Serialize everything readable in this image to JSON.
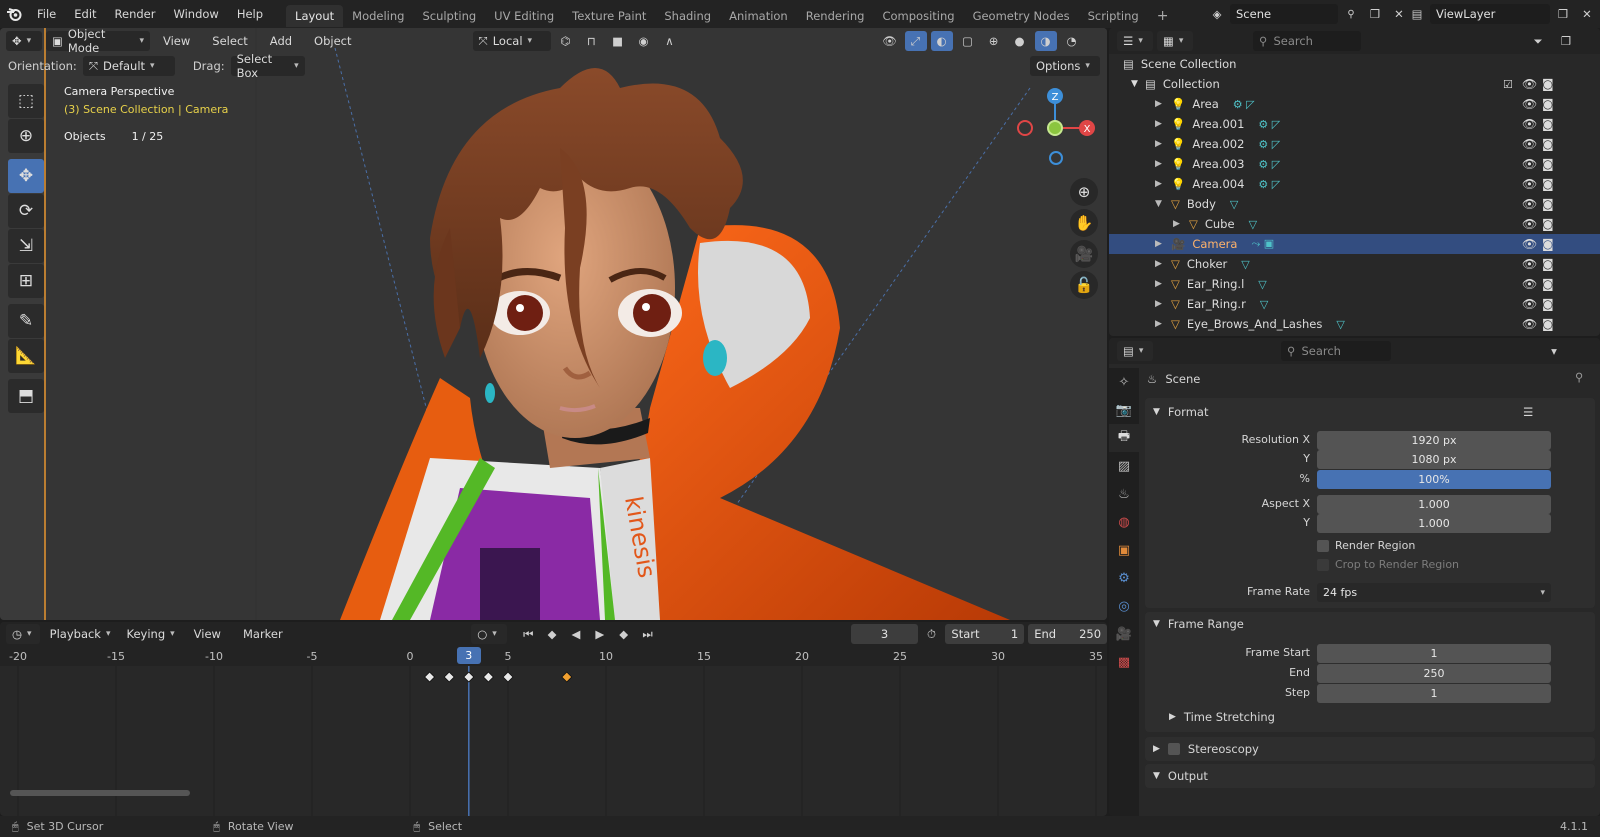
{
  "topbar": {
    "menus": [
      "File",
      "Edit",
      "Render",
      "Window",
      "Help"
    ],
    "workspaces": [
      "Layout",
      "Modeling",
      "Sculpting",
      "UV Editing",
      "Texture Paint",
      "Shading",
      "Animation",
      "Rendering",
      "Compositing",
      "Geometry Nodes",
      "Scripting"
    ],
    "active_workspace": "Layout",
    "scene": "Scene",
    "view_layer": "ViewLayer"
  },
  "viewport": {
    "mode": "Object Mode",
    "menus": [
      "View",
      "Select",
      "Add",
      "Object"
    ],
    "transform_orientation": "Local",
    "orientation_label": "Orientation:",
    "orientation_value": "Default",
    "drag_label": "Drag:",
    "drag_value": "Select Box",
    "options_label": "Options",
    "overlay_title": "Camera Perspective",
    "overlay_path": "(3) Scene Collection | Camera",
    "objects_label": "Objects",
    "objects_value": "1 / 25",
    "shirt_text": "kinesis",
    "gizmo_axes": {
      "z": "Z",
      "x": "X"
    }
  },
  "timeline": {
    "menus": [
      "Playback",
      "Keying",
      "View",
      "Marker"
    ],
    "current_frame": "3",
    "start_label": "Start",
    "start_value": "1",
    "end_label": "End",
    "end_value": "250",
    "ticks": [
      -20,
      -15,
      -10,
      -5,
      0,
      5,
      10,
      15,
      20,
      25,
      30,
      35
    ],
    "keyframes": [
      1,
      2,
      3,
      4,
      5
    ],
    "selected_keyframe": 8
  },
  "outliner": {
    "search_placeholder": "Search",
    "scene_collection": "Scene Collection",
    "collection": "Collection",
    "items": [
      {
        "name": "Area",
        "type": "light",
        "indent": 1
      },
      {
        "name": "Area.001",
        "type": "light",
        "indent": 1
      },
      {
        "name": "Area.002",
        "type": "light",
        "indent": 1
      },
      {
        "name": "Area.003",
        "type": "light",
        "indent": 1
      },
      {
        "name": "Area.004",
        "type": "light",
        "indent": 1
      },
      {
        "name": "Body",
        "type": "mesh",
        "indent": 1,
        "expanded": true
      },
      {
        "name": "Cube",
        "type": "mesh",
        "indent": 2
      },
      {
        "name": "Camera",
        "type": "camera",
        "indent": 1,
        "selected": true
      },
      {
        "name": "Choker",
        "type": "mesh",
        "indent": 1
      },
      {
        "name": "Ear_Ring.l",
        "type": "mesh",
        "indent": 1
      },
      {
        "name": "Ear_Ring.r",
        "type": "mesh",
        "indent": 1
      },
      {
        "name": "Eye_Brows_And_Lashes",
        "type": "mesh",
        "indent": 1
      }
    ]
  },
  "properties": {
    "search_placeholder": "Search",
    "context": "Scene",
    "format_title": "Format",
    "resolution_x_label": "Resolution X",
    "resolution_x": "1920 px",
    "y_label": "Y",
    "resolution_y": "1080 px",
    "percent_label": "%",
    "percent": "100%",
    "aspect_x_label": "Aspect X",
    "aspect_x": "1.000",
    "aspect_y": "1.000",
    "render_region": "Render Region",
    "crop_region": "Crop to Render Region",
    "frame_rate_label": "Frame Rate",
    "frame_rate": "24 fps",
    "frame_range_title": "Frame Range",
    "frame_start_label": "Frame Start",
    "frame_start": "1",
    "end_label": "End",
    "frame_end": "250",
    "step_label": "Step",
    "step": "1",
    "time_stretching": "Time Stretching",
    "stereoscopy": "Stereoscopy",
    "output": "Output"
  },
  "statusbar": {
    "hint1": "Set 3D Cursor",
    "hint2": "Rotate View",
    "hint3": "Select",
    "version": "4.1.1"
  },
  "colors": {
    "accent": "#4772b3",
    "selected_row": "#334d80",
    "keyframe_selected": "#f0a030",
    "x_axis": "#e04646",
    "y_axis": "#8bc53f",
    "z_axis": "#3d8fd9"
  }
}
